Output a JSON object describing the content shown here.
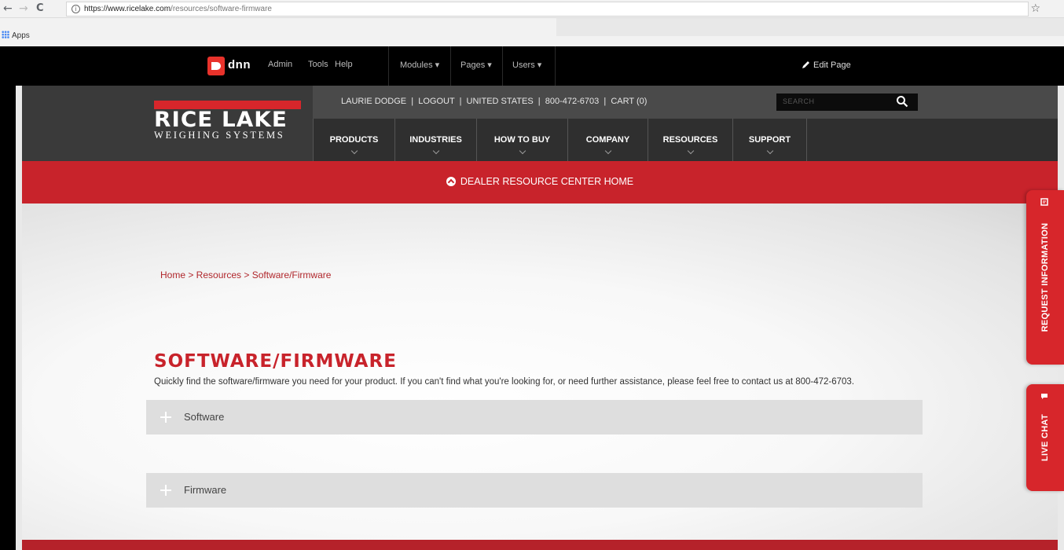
{
  "browser": {
    "back": "←",
    "forward": "→",
    "reload": "C",
    "url_host": "https://www.ricelake.com",
    "url_path": "/resources/software-firmware",
    "info": "i",
    "star": "☆",
    "bookmarks_apps": "Apps"
  },
  "dnn": {
    "logo_text": "dnn",
    "items": [
      "Admin",
      "Tools",
      "Help",
      "Modules ▾",
      "Pages ▾",
      "Users ▾"
    ],
    "edit_page": "Edit Page"
  },
  "header": {
    "logo_main": "RICE LAKE",
    "logo_sub": "WEIGHING SYSTEMS",
    "utility": "LAURIE DODGE  |  LOGOUT  |  UNITED STATES  |  800-472-6703  |  CART (0)",
    "search_placeholder": "SEARCH",
    "nav": [
      "PRODUCTS",
      "INDUSTRIES",
      "HOW TO BUY",
      "COMPANY",
      "RESOURCES",
      "SUPPORT"
    ]
  },
  "banner": {
    "label": "DEALER RESOURCE CENTER HOME"
  },
  "main": {
    "breadcrumb": "Home > Resources > Software/Firmware",
    "title": "SOFTWARE/FIRMWARE",
    "intro": "Quickly find the software/firmware you need for your product. If you can't find what you're looking for, or need further assistance, please feel free to contact us at 800-472-6703.",
    "accordions": [
      "Software",
      "Firmware"
    ]
  },
  "side_tabs": {
    "request": "REQUEST INFORMATION",
    "chat": "LIVE CHAT"
  },
  "colors": {
    "brand_red": "#c8232b",
    "dark": "#2f2f2f"
  }
}
